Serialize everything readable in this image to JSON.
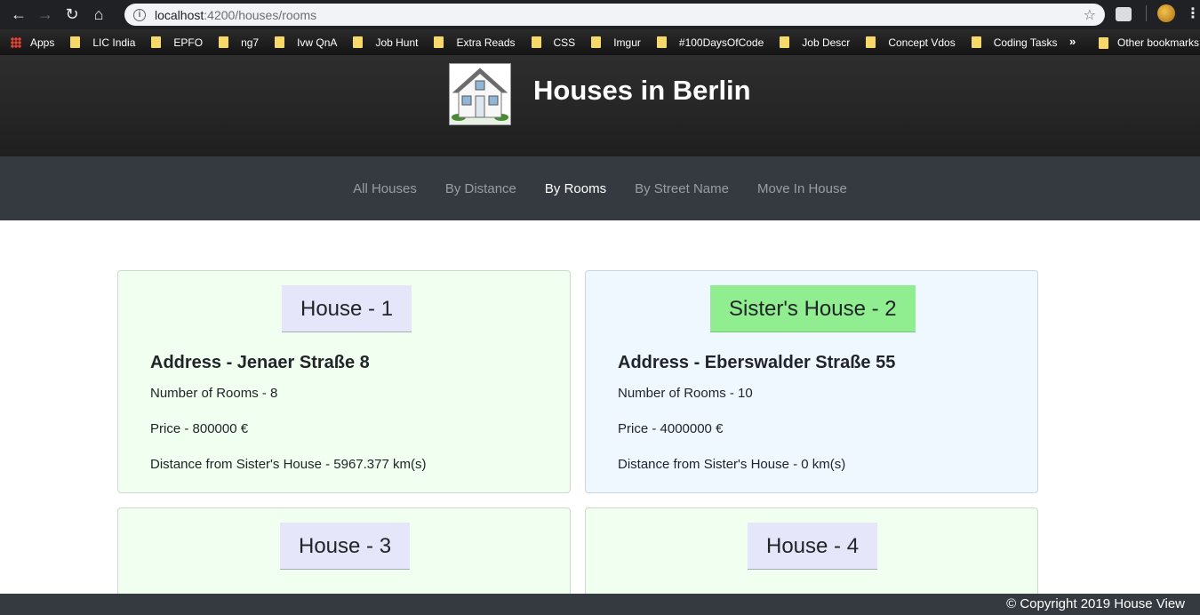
{
  "browser": {
    "url_host": "localhost",
    "url_path": ":4200/houses/rooms",
    "bookmarks": [
      "Apps",
      "LIC India",
      "EPFO",
      "ng7",
      "Ivw QnA",
      "Job Hunt",
      "Extra Reads",
      "CSS",
      "Imgur",
      "#100DaysOfCode",
      "Job Descr",
      "Concept Vdos",
      "Coding Tasks"
    ],
    "more_label": "»",
    "other_bookmarks": "Other bookmarks"
  },
  "header": {
    "title": "Houses in Berlin"
  },
  "nav": {
    "items": [
      "All Houses",
      "By Distance",
      "By Rooms",
      "By Street Name",
      "Move In House"
    ],
    "active": "By Rooms"
  },
  "houses": [
    {
      "title": "House - 1",
      "address": "Address - Jenaer Straße 8",
      "rooms": "Number of Rooms - 8",
      "price": "Price - 800000 €",
      "distance": "Distance from Sister's House - 5967.377 km(s)"
    },
    {
      "title": "Sister's House - 2",
      "address": "Address - Eberswalder Straße 55",
      "rooms": "Number of Rooms - 10",
      "price": "Price - 4000000 €",
      "distance": "Distance from Sister's House - 0 km(s)"
    },
    {
      "title": "House - 3"
    },
    {
      "title": "House - 4"
    }
  ],
  "colors": {
    "card_green": "#f0fff0",
    "card_blue": "#f0f8ff",
    "title_bg": "#e6e6fa",
    "sister_title_bg": "#90ee90",
    "nav_bg": "#343a40"
  },
  "footer": {
    "copyright": "© Copyright 2019 House View"
  }
}
